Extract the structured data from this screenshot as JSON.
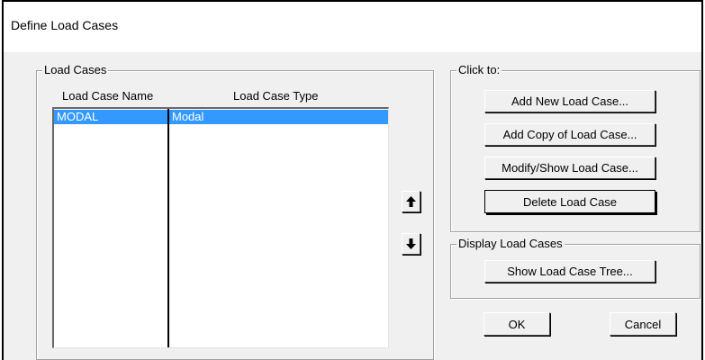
{
  "window": {
    "title": "Define Load Cases"
  },
  "load_cases": {
    "group_label": "Load Cases",
    "columns": [
      "Load Case Name",
      "Load Case Type"
    ],
    "rows": [
      {
        "name": "MODAL",
        "type": "Modal",
        "selected": true
      }
    ]
  },
  "reorder": {
    "up_icon": "arrow-up-icon",
    "down_icon": "arrow-down-icon"
  },
  "click_to": {
    "group_label": "Click to:",
    "add_new": "Add New Load Case...",
    "add_copy": "Add Copy of Load Case...",
    "modify_show": "Modify/Show Load Case...",
    "delete": "Delete Load Case"
  },
  "display": {
    "group_label": "Display Load Cases",
    "show_tree": "Show Load Case Tree..."
  },
  "footer": {
    "ok": "OK",
    "cancel": "Cancel"
  },
  "colors": {
    "selection": "#3399ff",
    "dialog_bg": "#f0f0f0"
  }
}
